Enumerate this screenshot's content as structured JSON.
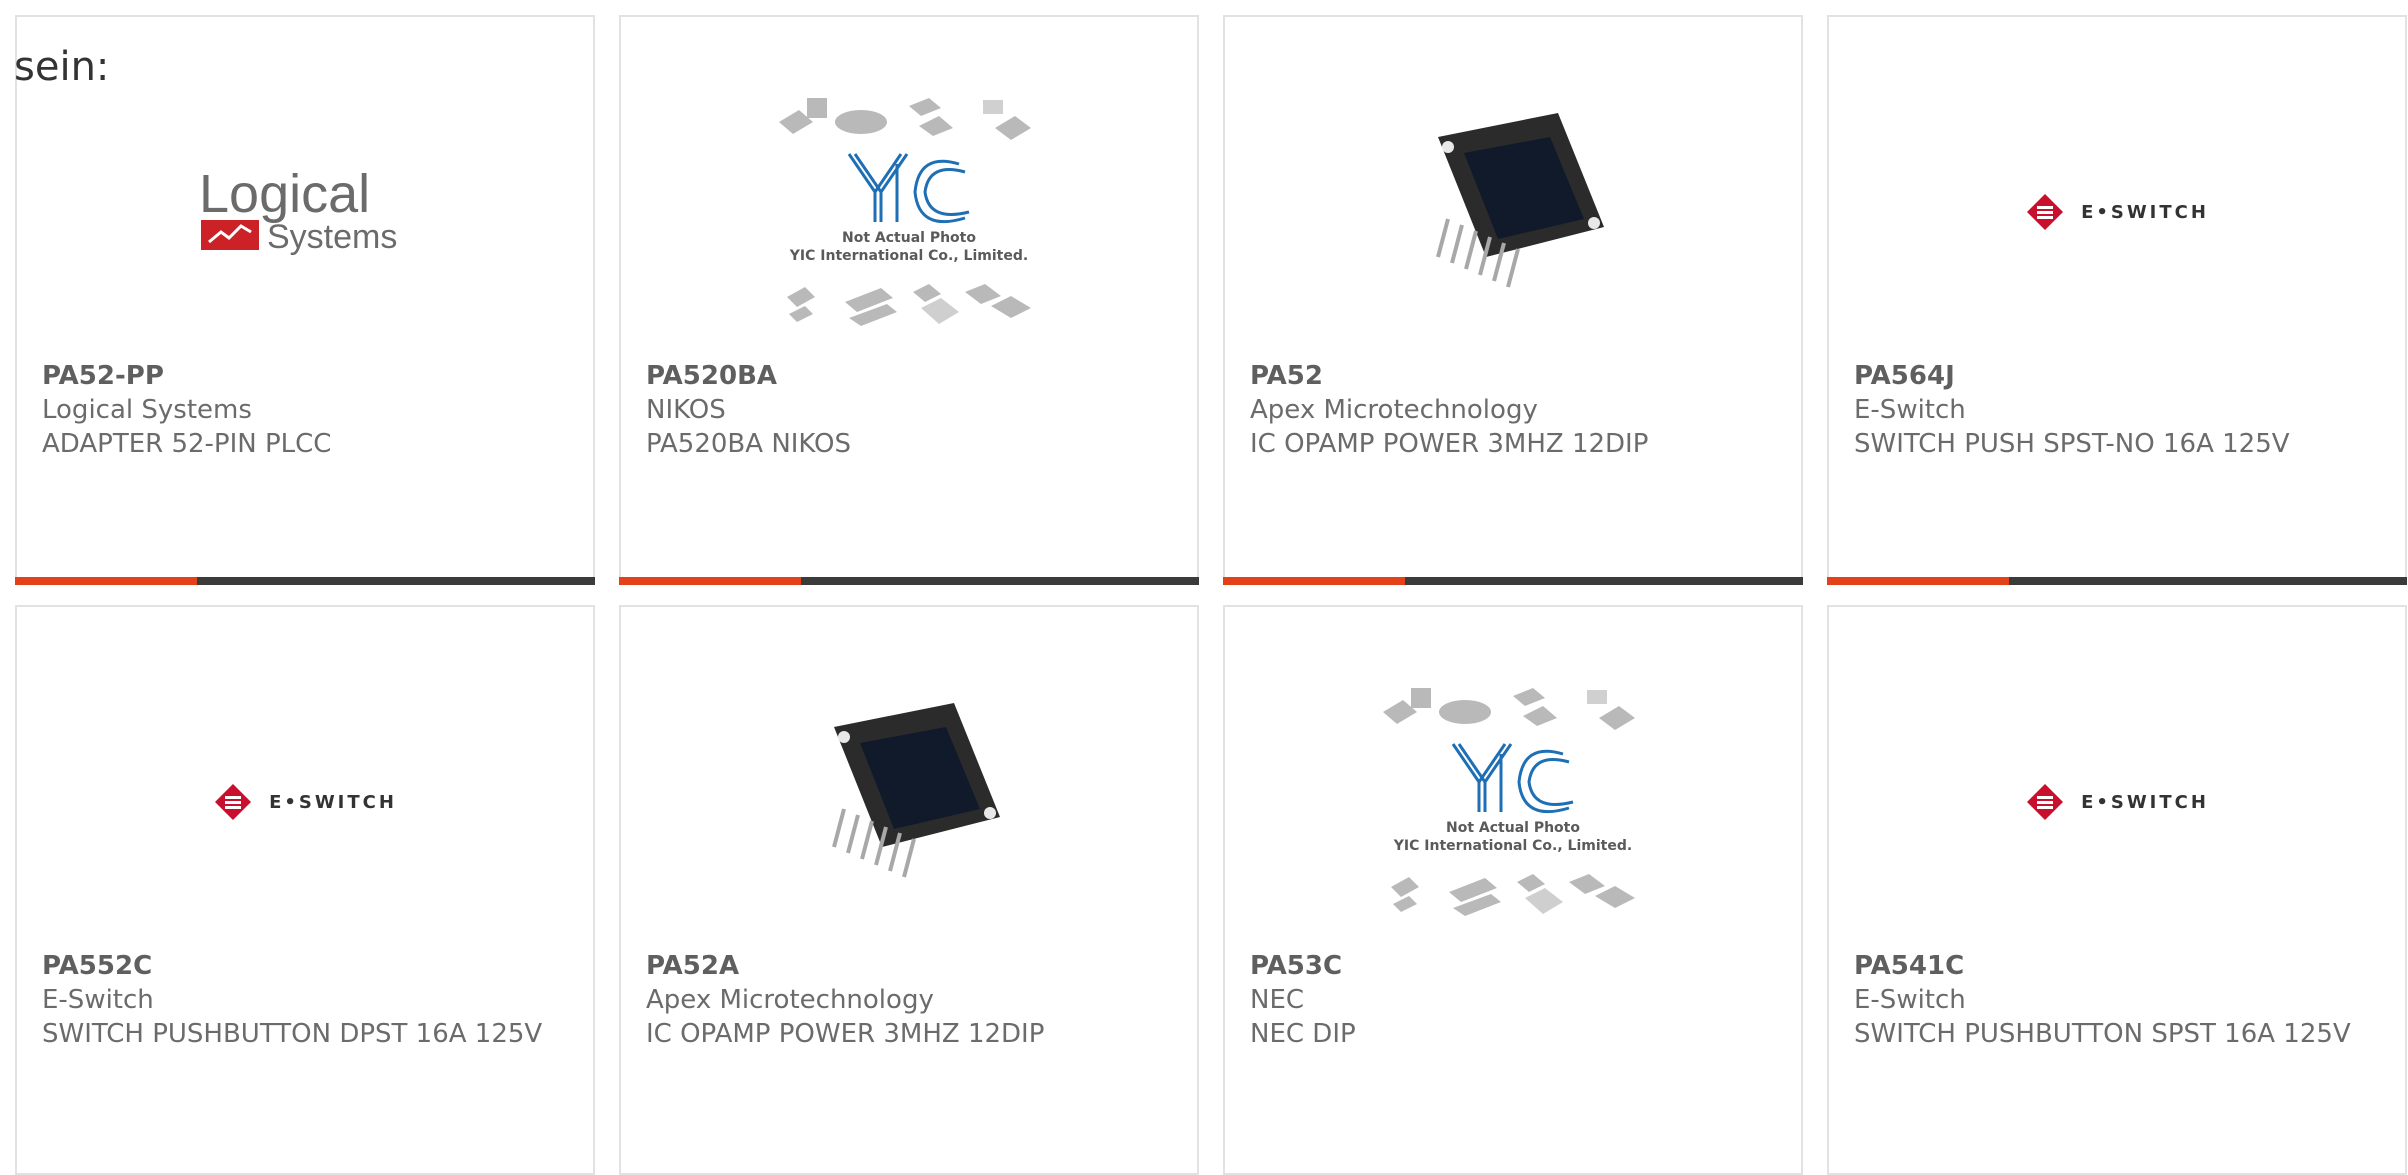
{
  "intro_text": "sein:",
  "colors": {
    "accent": "#e34119",
    "bar_dark": "#3b3b3b",
    "eswitch_red": "#c8102e",
    "yic_blue": "#1f6fb5"
  },
  "cards": [
    {
      "part_number": "PA52-PP",
      "manufacturer": "Logical Systems",
      "description": "ADAPTER 52-PIN PLCC",
      "image": "logical-systems-logo",
      "logo_line1": "Logical",
      "logo_line2": "Systems"
    },
    {
      "part_number": "PA520BA",
      "manufacturer": "NIKOS",
      "description": "PA520BA NIKOS",
      "image": "yic-placeholder",
      "photo_note1": "Not Actual Photo",
      "photo_note2": "YIC International Co., Limited."
    },
    {
      "part_number": "PA52",
      "manufacturer": "Apex Microtechnology",
      "description": "IC OPAMP POWER 3MHZ 12DIP",
      "image": "opamp-module-photo"
    },
    {
      "part_number": "PA564J",
      "manufacturer": "E-Switch",
      "description": "SWITCH PUSH SPST-NO 16A 125V",
      "image": "eswitch-logo",
      "logo_text": "E•SWITCH"
    },
    {
      "part_number": "PA552C",
      "manufacturer": "E-Switch",
      "description": "SWITCH PUSHBUTTON DPST 16A 125V",
      "image": "eswitch-logo",
      "logo_text": "E•SWITCH"
    },
    {
      "part_number": "PA52A",
      "manufacturer": "Apex Microtechnology",
      "description": "IC OPAMP POWER 3MHZ 12DIP",
      "image": "opamp-module-photo"
    },
    {
      "part_number": "PA53C",
      "manufacturer": "NEC",
      "description": "NEC DIP",
      "image": "yic-placeholder",
      "photo_note1": "Not Actual Photo",
      "photo_note2": "YIC International Co., Limited."
    },
    {
      "part_number": "PA541C",
      "manufacturer": "E-Switch",
      "description": "SWITCH PUSHBUTTON SPST 16A 125V",
      "image": "eswitch-logo",
      "logo_text": "E•SWITCH"
    }
  ]
}
